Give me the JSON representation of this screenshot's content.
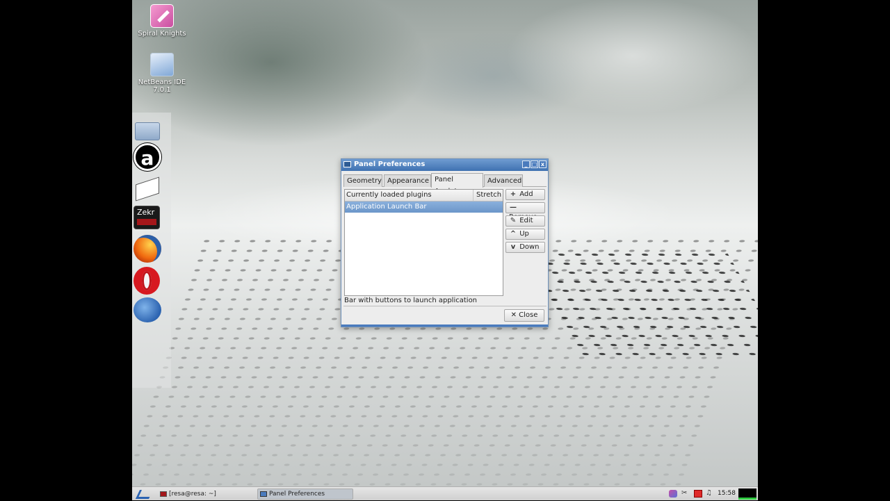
{
  "desktop": {
    "icons": [
      {
        "label": "Spiral Knights",
        "icon": "spiral-knights-icon"
      },
      {
        "label_line1": "NetBeans IDE",
        "label_line2": "7.0.1",
        "icon": "netbeans-icon"
      }
    ]
  },
  "dock": {
    "items": [
      {
        "icon": "file-manager-icon"
      },
      {
        "icon": "amazon-icon"
      },
      {
        "icon": "ebook-reader-icon"
      },
      {
        "icon": "zekr-icon",
        "label": "Zekr"
      },
      {
        "icon": "firefox-icon"
      },
      {
        "icon": "opera-icon"
      },
      {
        "icon": "thunderbird-icon"
      }
    ]
  },
  "window": {
    "title": "Panel Preferences",
    "controls": {
      "minimize": "_",
      "maximize": "□",
      "close": "x"
    },
    "tabs": [
      {
        "label": "Geometry",
        "active": false
      },
      {
        "label": "Appearance",
        "active": false
      },
      {
        "label": "Panel Applets",
        "active": true
      },
      {
        "label": "Advanced",
        "active": false
      }
    ],
    "list": {
      "columns": [
        "Currently loaded plugins",
        "Stretch"
      ],
      "rows": [
        {
          "name": "Application Launch Bar",
          "selected": true
        }
      ]
    },
    "side_buttons": [
      {
        "label": "Add",
        "icon": "plus-icon",
        "glyph": "+"
      },
      {
        "label": "Remove",
        "icon": "minus-icon",
        "glyph": "—"
      },
      {
        "label": "Edit",
        "icon": "pencil-icon",
        "glyph": "✎"
      },
      {
        "label": "Up",
        "icon": "arrow-up-icon",
        "glyph": "^"
      },
      {
        "label": "Down",
        "icon": "arrow-down-icon",
        "glyph": "v"
      }
    ],
    "description": "Bar with buttons to launch application",
    "close_button": {
      "label": "Close",
      "glyph": "✕"
    }
  },
  "taskbar": {
    "tasks": [
      {
        "label": "[resa@resa: ~]",
        "icon": "terminal-icon"
      },
      {
        "label": "Panel Preferences",
        "icon": "window-icon",
        "active": true
      }
    ],
    "clock": "15:58",
    "tray": [
      "pidgin-icon",
      "network-icon",
      "red-square-icon",
      "volume-icon",
      "cpu-monitor-icon"
    ],
    "colors": {
      "accent": "#4a7bbd",
      "selection": "#7aa3d4"
    }
  }
}
